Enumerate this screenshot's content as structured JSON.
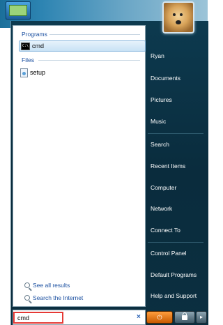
{
  "left_pane": {
    "groups": [
      {
        "heading": "Programs",
        "items": [
          {
            "label": "cmd",
            "icon": "cmd-icon"
          }
        ]
      },
      {
        "heading": "Files",
        "items": [
          {
            "label": "setup",
            "icon": "setup-icon"
          }
        ]
      }
    ],
    "links": [
      {
        "label": "See all results",
        "icon": "search-icon"
      },
      {
        "label": "Search the Internet",
        "icon": "search-icon"
      }
    ]
  },
  "search": {
    "value": "cmd",
    "clear_glyph": "×"
  },
  "right_pane": {
    "items": [
      "Ryan",
      "Documents",
      "Pictures",
      "Music",
      "Search",
      "Recent Items",
      "Computer",
      "Network",
      "Connect To",
      "Control Panel",
      "Default Programs",
      "Help and Support"
    ]
  },
  "power_buttons": {
    "power_icon": "power-icon",
    "lock_icon": "lock-icon",
    "arrow_icon": "arrow-icon"
  },
  "colors": {
    "accent": "#1a4fa0",
    "menu_bg": "#0d3a4f",
    "highlight": "#e53935"
  }
}
